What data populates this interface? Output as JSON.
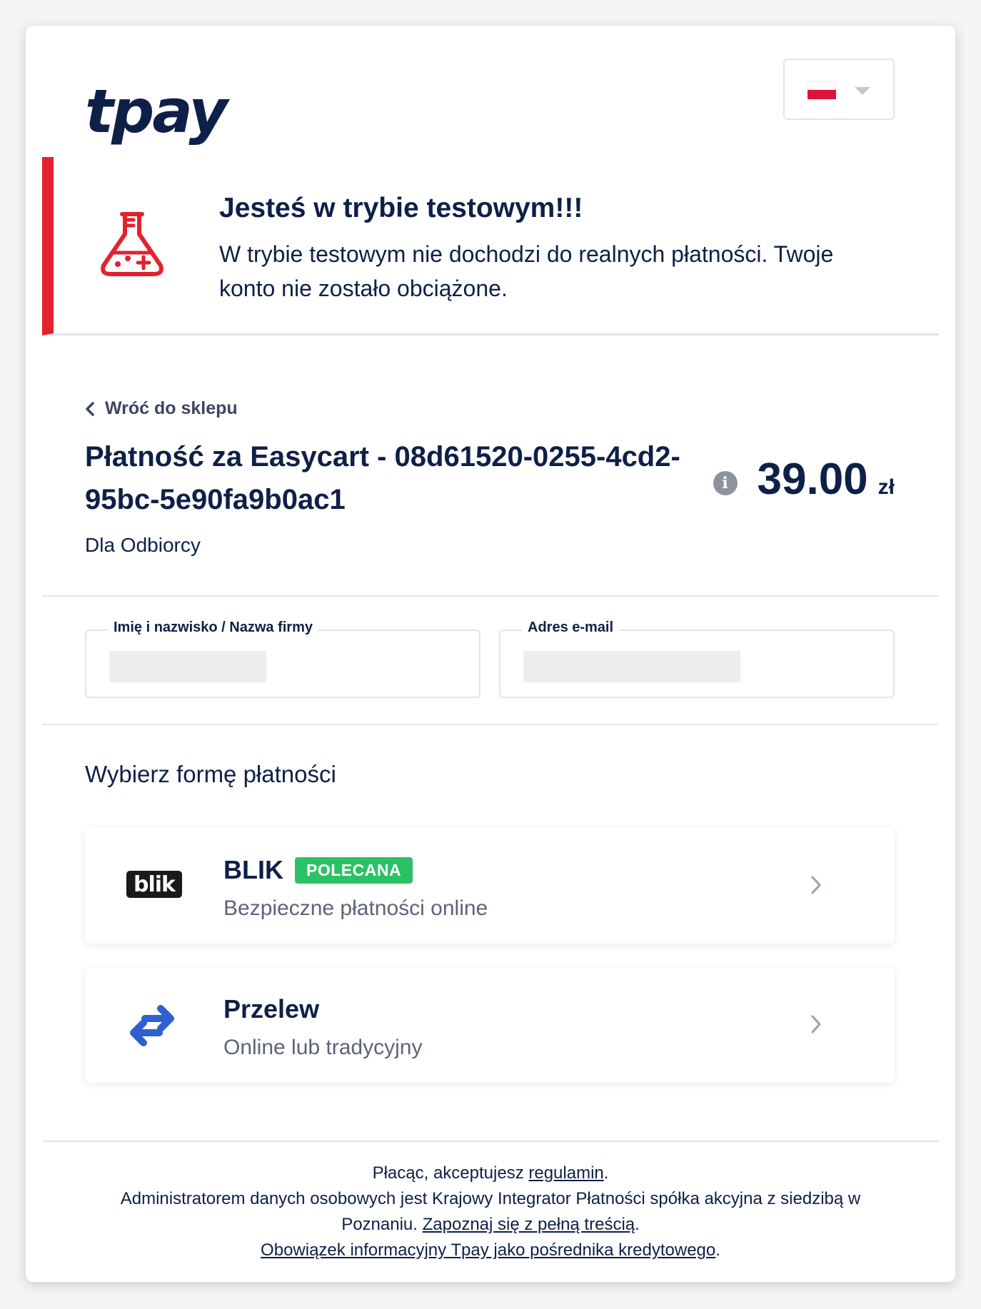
{
  "header": {
    "logo_text": "tpay",
    "language": "pl"
  },
  "banner": {
    "title": "Jesteś w trybie testowym!!!",
    "text": "W trybie testowym nie dochodzi do realnych płatności. Twoje konto nie zostało obciążone."
  },
  "order": {
    "back_label": "Wróć do sklepu",
    "title": "Płatność za Easycart - 08d61520-0255-4cd2-95bc-5e90fa9b0ac1",
    "amount": "39.00",
    "currency": "zł",
    "recipient": "Dla Odbiorcy"
  },
  "form": {
    "name_label": "Imię i nazwisko / Nazwa firmy",
    "name_value": "",
    "email_label": "Adres e-mail",
    "email_value": ""
  },
  "payment": {
    "section_title": "Wybierz formę płatności",
    "methods": [
      {
        "name": "BLIK",
        "badge": "POLECANA",
        "description": "Bezpieczne płatności online",
        "logo_text": "blik"
      },
      {
        "name": "Przelew",
        "description": "Online lub tradycyjny"
      }
    ]
  },
  "footer": {
    "line1_prefix": "Płacąc, akceptujesz ",
    "terms_link": "regulamin",
    "line1_suffix": ".",
    "line2": "Administratorem danych osobowych jest Krajowy Integrator Płatności spółka akcyjna z siedzibą w Poznaniu. ",
    "privacy_link": "Zapoznaj się z pełną treścią",
    "line2_suffix": ".",
    "info_link": "Obowiązek informacyjny Tpay jako pośrednika kredytowego",
    "line3_suffix": "."
  },
  "colors": {
    "brand": "#0e2047",
    "test_red": "#e3222d",
    "recommended_green": "#2bc266",
    "transfer_blue": "#2f5fd0"
  }
}
